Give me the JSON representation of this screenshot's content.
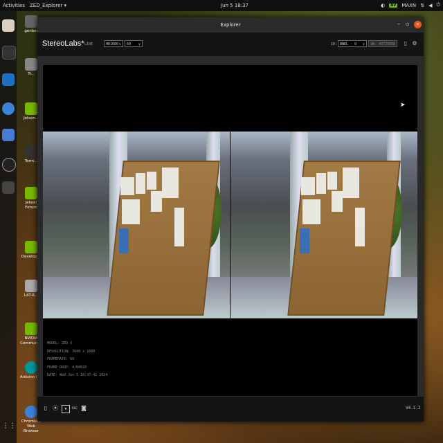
{
  "topbar": {
    "activities": "Activities",
    "app_menu": "ZED_Explorer ▾",
    "clock": "Jun 5  18:37",
    "tray_badge": "MAXN"
  },
  "desktop_icons": [
    {
      "label": "genbot"
    },
    {
      "label": "Tr..."
    },
    {
      "label": "Jetson..."
    },
    {
      "label": "Term..."
    },
    {
      "label": "Jetson Forum"
    },
    {
      "label": "Developer"
    },
    {
      "label": "L4T-R..."
    },
    {
      "label": "NVIDIA Community"
    },
    {
      "label": "Arduino IDE"
    },
    {
      "label": "Chromium Web Browser"
    }
  ],
  "window": {
    "title": "Explorer",
    "minimize": "–",
    "maximize": "▫",
    "close": "×"
  },
  "toolbar": {
    "logo": "StereoLabs*",
    "mode": "LIVE",
    "resolution": "HD1080",
    "fps": "60",
    "id_label": "ID:",
    "id_value": "BNEL - 0",
    "sn_label": "SN:",
    "sn_value": "40729998"
  },
  "info": {
    "model": "MODEL: ZED X",
    "resolution": "RESOLUTION: 3840 x 1080",
    "framerate": "FRAMERATE: 60",
    "frame_drop": "FRAME DROP: 4/60020",
    "date": "DATE: Wed Jun 5 18:37:41 2024"
  },
  "bottombar": {
    "version": "V4.1.2",
    "rec_label": "REC"
  },
  "colors": {
    "accent_close": "#e95420",
    "nvidia": "#76b900"
  }
}
